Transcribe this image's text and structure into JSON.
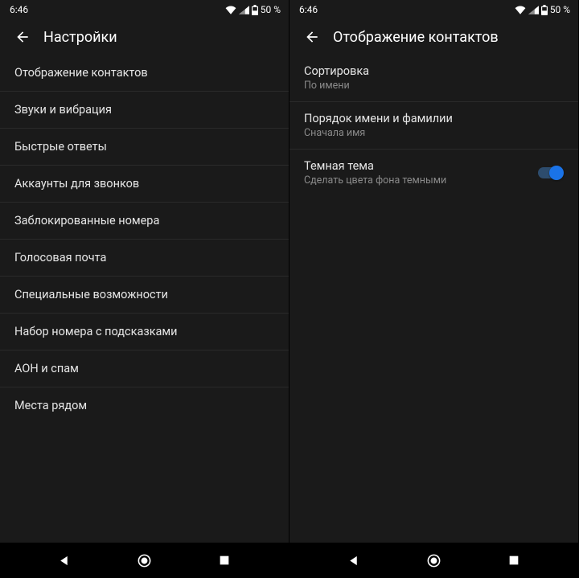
{
  "left": {
    "status": {
      "time": "6:46",
      "battery_pct": "50 %"
    },
    "header": {
      "title": "Настройки"
    },
    "items": [
      {
        "label": "Отображение контактов"
      },
      {
        "label": "Звуки и вибрация"
      },
      {
        "label": "Быстрые ответы"
      },
      {
        "label": "Аккаунты для звонков"
      },
      {
        "label": "Заблокированные номера"
      },
      {
        "label": "Голосовая почта"
      },
      {
        "label": "Специальные возможности"
      },
      {
        "label": "Набор номера с подсказками"
      },
      {
        "label": "АОН и спам"
      },
      {
        "label": "Места рядом"
      }
    ]
  },
  "right": {
    "status": {
      "time": "6:46",
      "battery_pct": "50 %"
    },
    "header": {
      "title": "Отображение контактов"
    },
    "items": [
      {
        "title": "Сортировка",
        "sub": "По имени",
        "toggle": false
      },
      {
        "title": "Порядок имени и фамилии",
        "sub": "Сначала имя",
        "toggle": false
      },
      {
        "title": "Темная тема",
        "sub": "Сделать цвета фона темными",
        "toggle": true,
        "toggle_on": true
      }
    ]
  }
}
